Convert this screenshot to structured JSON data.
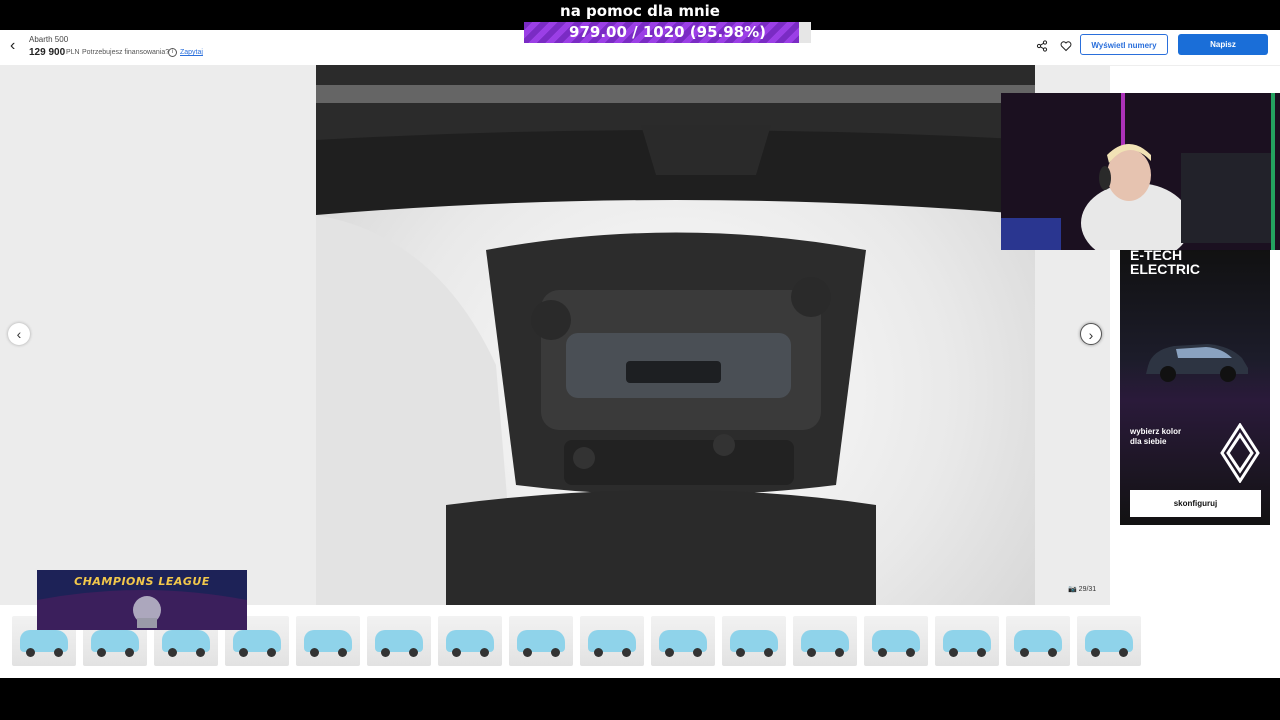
{
  "stream_overlay": {
    "donation_title": "na pomoc dla mnie",
    "donation_progress_text": "979.00 / 1020 (95.98%)",
    "donation_progress_fraction": 0.9598,
    "bar_fill_color": "#8a35d6",
    "champions_league_text": "CHAMPIONS LEAGUE"
  },
  "header": {
    "car_name": "Abarth 500",
    "price": "129 900",
    "currency": "PLN",
    "financing_question": "Potrzebujesz finansowania?",
    "ask_link": "Zapytaj",
    "show_numbers_button": "Wyświetl numery",
    "write_button": "Napisz",
    "accent_color": "#1a6ed8"
  },
  "gallery": {
    "photo_counter": "29/31",
    "thumbnails_count": 16
  },
  "ad": {
    "title": "E-TECH\nELECTRIC",
    "subtitle": "wybierz kolor\ndla siebie",
    "button_label": "skonfiguruj"
  }
}
